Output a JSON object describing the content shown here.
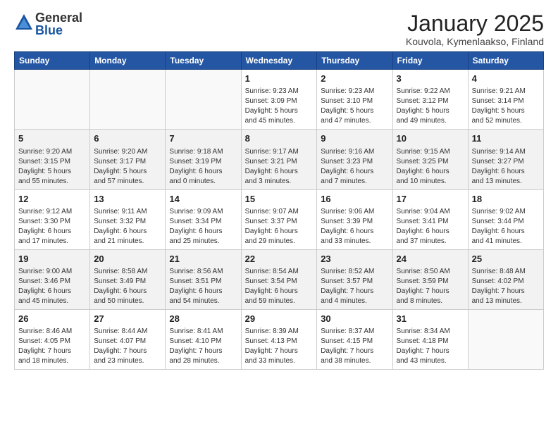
{
  "header": {
    "logo_general": "General",
    "logo_blue": "Blue",
    "month_title": "January 2025",
    "location": "Kouvola, Kymenlaakso, Finland"
  },
  "days_of_week": [
    "Sunday",
    "Monday",
    "Tuesday",
    "Wednesday",
    "Thursday",
    "Friday",
    "Saturday"
  ],
  "weeks": [
    [
      {
        "day": "",
        "info": ""
      },
      {
        "day": "",
        "info": ""
      },
      {
        "day": "",
        "info": ""
      },
      {
        "day": "1",
        "info": "Sunrise: 9:23 AM\nSunset: 3:09 PM\nDaylight: 5 hours\nand 45 minutes."
      },
      {
        "day": "2",
        "info": "Sunrise: 9:23 AM\nSunset: 3:10 PM\nDaylight: 5 hours\nand 47 minutes."
      },
      {
        "day": "3",
        "info": "Sunrise: 9:22 AM\nSunset: 3:12 PM\nDaylight: 5 hours\nand 49 minutes."
      },
      {
        "day": "4",
        "info": "Sunrise: 9:21 AM\nSunset: 3:14 PM\nDaylight: 5 hours\nand 52 minutes."
      }
    ],
    [
      {
        "day": "5",
        "info": "Sunrise: 9:20 AM\nSunset: 3:15 PM\nDaylight: 5 hours\nand 55 minutes."
      },
      {
        "day": "6",
        "info": "Sunrise: 9:20 AM\nSunset: 3:17 PM\nDaylight: 5 hours\nand 57 minutes."
      },
      {
        "day": "7",
        "info": "Sunrise: 9:18 AM\nSunset: 3:19 PM\nDaylight: 6 hours\nand 0 minutes."
      },
      {
        "day": "8",
        "info": "Sunrise: 9:17 AM\nSunset: 3:21 PM\nDaylight: 6 hours\nand 3 minutes."
      },
      {
        "day": "9",
        "info": "Sunrise: 9:16 AM\nSunset: 3:23 PM\nDaylight: 6 hours\nand 7 minutes."
      },
      {
        "day": "10",
        "info": "Sunrise: 9:15 AM\nSunset: 3:25 PM\nDaylight: 6 hours\nand 10 minutes."
      },
      {
        "day": "11",
        "info": "Sunrise: 9:14 AM\nSunset: 3:27 PM\nDaylight: 6 hours\nand 13 minutes."
      }
    ],
    [
      {
        "day": "12",
        "info": "Sunrise: 9:12 AM\nSunset: 3:30 PM\nDaylight: 6 hours\nand 17 minutes."
      },
      {
        "day": "13",
        "info": "Sunrise: 9:11 AM\nSunset: 3:32 PM\nDaylight: 6 hours\nand 21 minutes."
      },
      {
        "day": "14",
        "info": "Sunrise: 9:09 AM\nSunset: 3:34 PM\nDaylight: 6 hours\nand 25 minutes."
      },
      {
        "day": "15",
        "info": "Sunrise: 9:07 AM\nSunset: 3:37 PM\nDaylight: 6 hours\nand 29 minutes."
      },
      {
        "day": "16",
        "info": "Sunrise: 9:06 AM\nSunset: 3:39 PM\nDaylight: 6 hours\nand 33 minutes."
      },
      {
        "day": "17",
        "info": "Sunrise: 9:04 AM\nSunset: 3:41 PM\nDaylight: 6 hours\nand 37 minutes."
      },
      {
        "day": "18",
        "info": "Sunrise: 9:02 AM\nSunset: 3:44 PM\nDaylight: 6 hours\nand 41 minutes."
      }
    ],
    [
      {
        "day": "19",
        "info": "Sunrise: 9:00 AM\nSunset: 3:46 PM\nDaylight: 6 hours\nand 45 minutes."
      },
      {
        "day": "20",
        "info": "Sunrise: 8:58 AM\nSunset: 3:49 PM\nDaylight: 6 hours\nand 50 minutes."
      },
      {
        "day": "21",
        "info": "Sunrise: 8:56 AM\nSunset: 3:51 PM\nDaylight: 6 hours\nand 54 minutes."
      },
      {
        "day": "22",
        "info": "Sunrise: 8:54 AM\nSunset: 3:54 PM\nDaylight: 6 hours\nand 59 minutes."
      },
      {
        "day": "23",
        "info": "Sunrise: 8:52 AM\nSunset: 3:57 PM\nDaylight: 7 hours\nand 4 minutes."
      },
      {
        "day": "24",
        "info": "Sunrise: 8:50 AM\nSunset: 3:59 PM\nDaylight: 7 hours\nand 8 minutes."
      },
      {
        "day": "25",
        "info": "Sunrise: 8:48 AM\nSunset: 4:02 PM\nDaylight: 7 hours\nand 13 minutes."
      }
    ],
    [
      {
        "day": "26",
        "info": "Sunrise: 8:46 AM\nSunset: 4:05 PM\nDaylight: 7 hours\nand 18 minutes."
      },
      {
        "day": "27",
        "info": "Sunrise: 8:44 AM\nSunset: 4:07 PM\nDaylight: 7 hours\nand 23 minutes."
      },
      {
        "day": "28",
        "info": "Sunrise: 8:41 AM\nSunset: 4:10 PM\nDaylight: 7 hours\nand 28 minutes."
      },
      {
        "day": "29",
        "info": "Sunrise: 8:39 AM\nSunset: 4:13 PM\nDaylight: 7 hours\nand 33 minutes."
      },
      {
        "day": "30",
        "info": "Sunrise: 8:37 AM\nSunset: 4:15 PM\nDaylight: 7 hours\nand 38 minutes."
      },
      {
        "day": "31",
        "info": "Sunrise: 8:34 AM\nSunset: 4:18 PM\nDaylight: 7 hours\nand 43 minutes."
      },
      {
        "day": "",
        "info": ""
      }
    ]
  ]
}
